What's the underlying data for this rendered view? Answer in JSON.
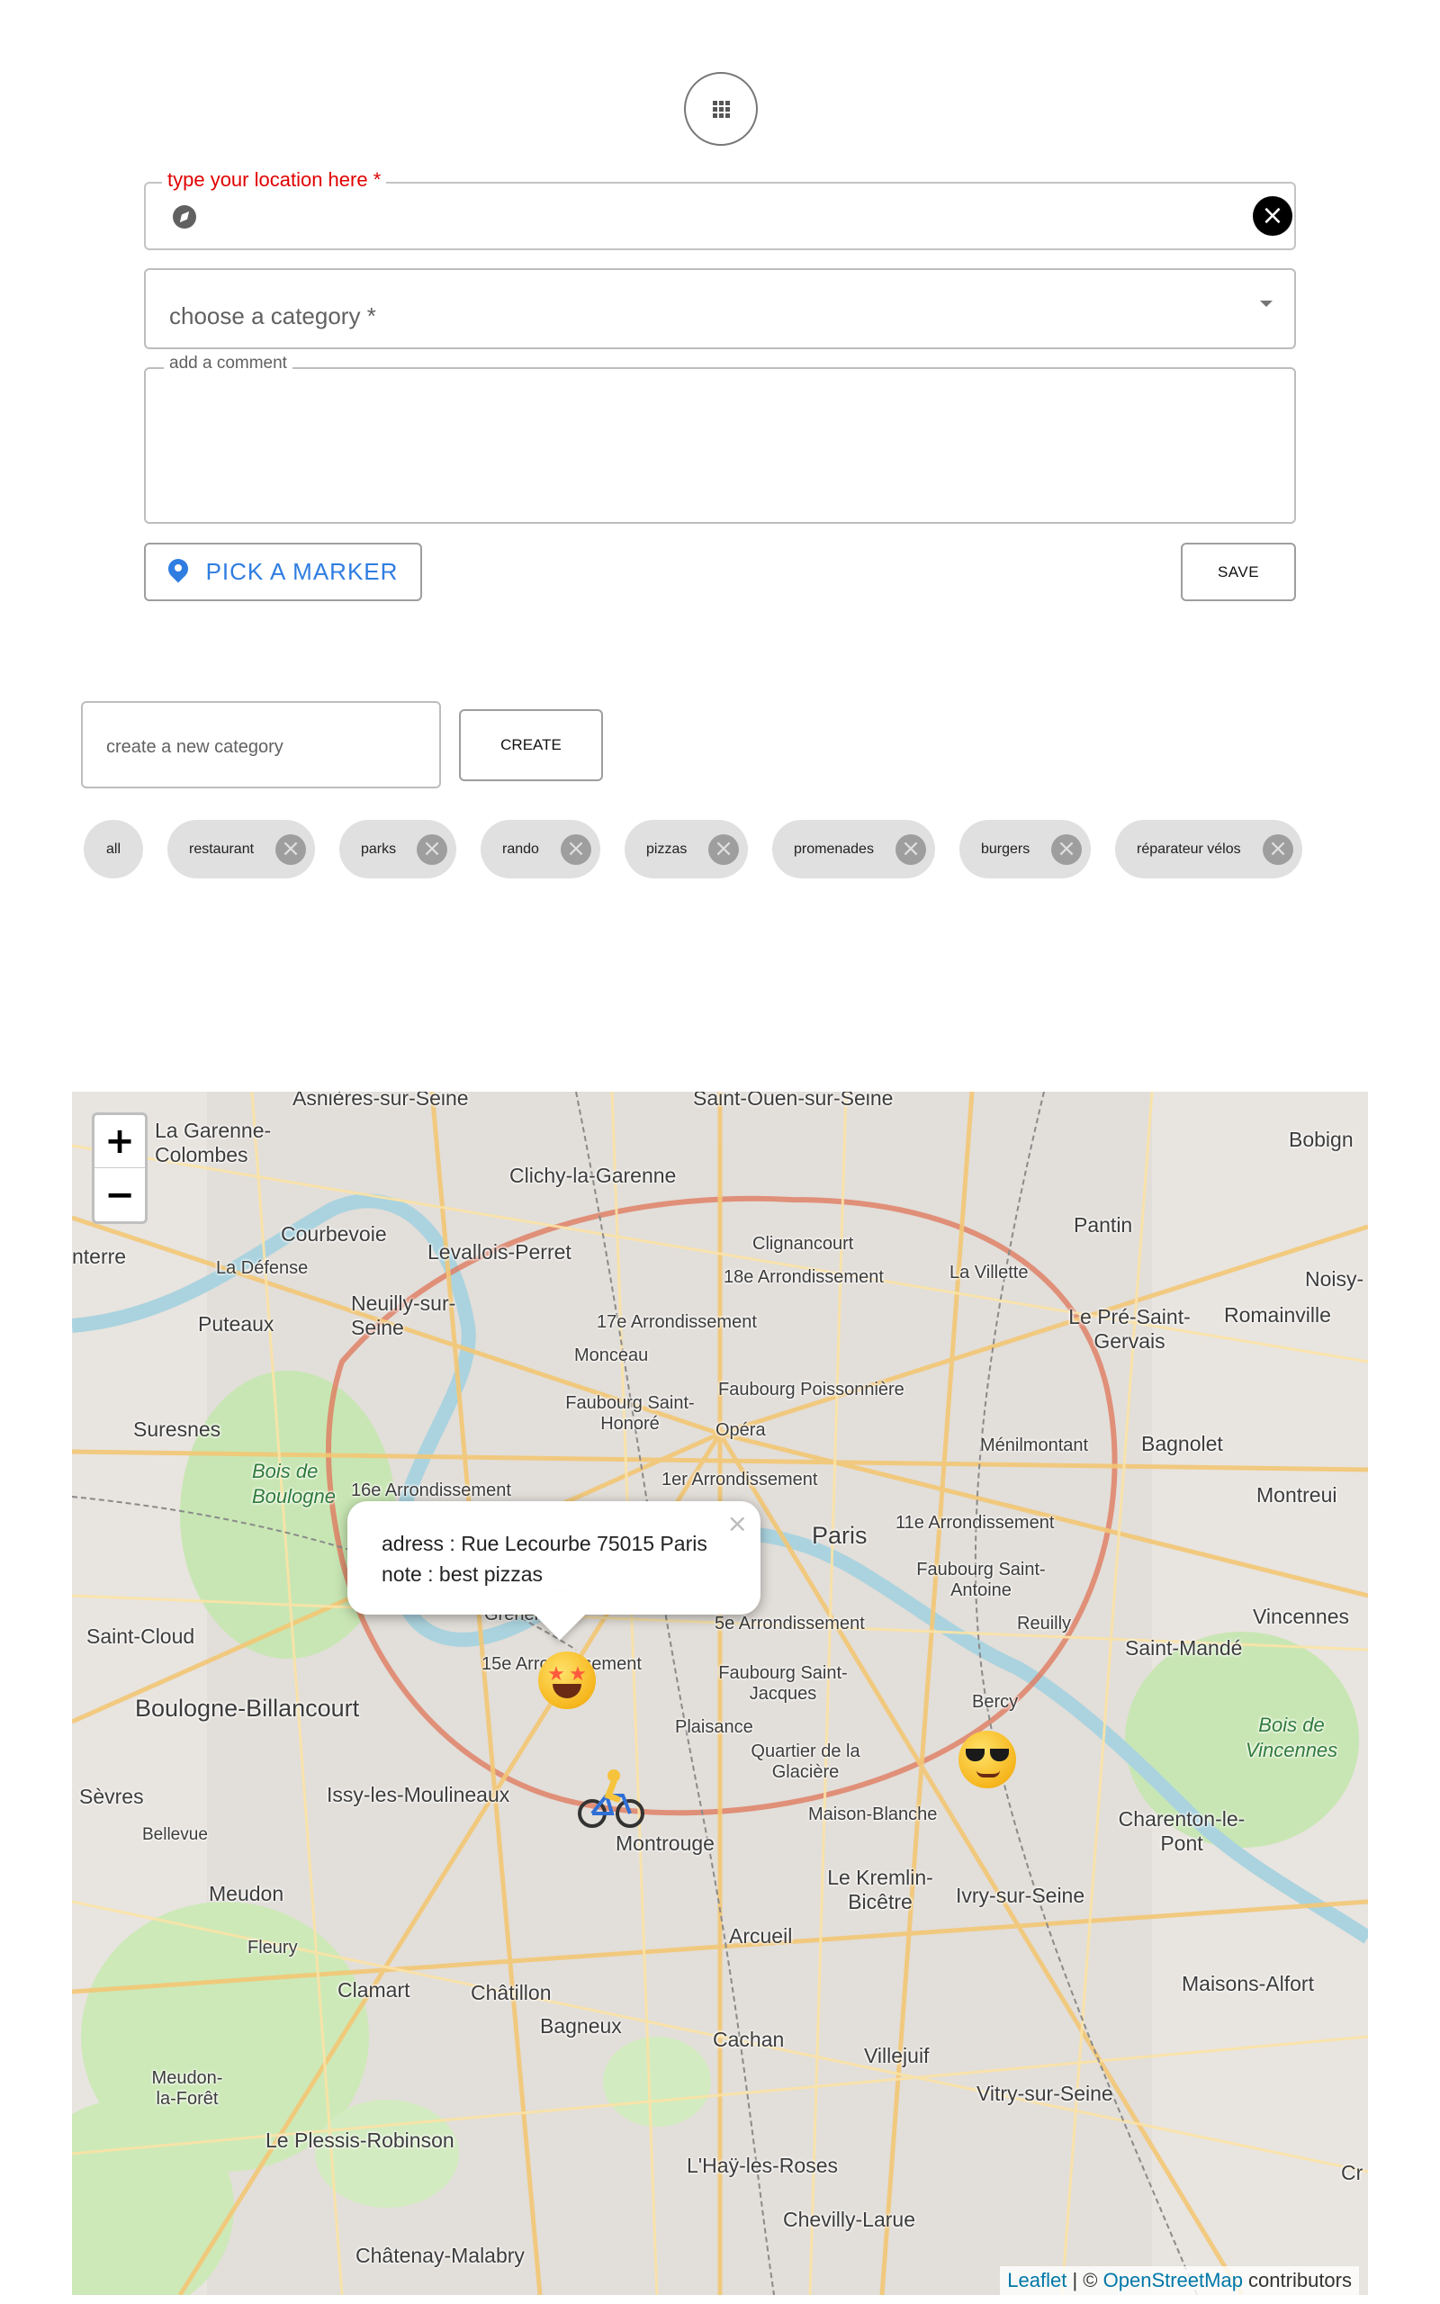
{
  "top": {
    "apps_icon": "apps-grid-icon"
  },
  "form": {
    "location": {
      "label": "type your location here *",
      "value": "",
      "left_icon": "compass-icon",
      "clear_icon": "close-circle-icon"
    },
    "category": {
      "placeholder": "choose a category *",
      "icon": "caret-down-icon"
    },
    "comment": {
      "label": "add a comment",
      "value": ""
    },
    "pick_marker": {
      "label": "PICK A MARKER",
      "icon": "map-pin-icon"
    },
    "save_label": "SAVE"
  },
  "category_manager": {
    "new_category_placeholder": "create a new category",
    "create_label": "CREATE"
  },
  "chips": [
    {
      "label": "all",
      "removable": false
    },
    {
      "label": "restaurant",
      "removable": true
    },
    {
      "label": "parks",
      "removable": true
    },
    {
      "label": "rando",
      "removable": true
    },
    {
      "label": "pizzas",
      "removable": true
    },
    {
      "label": "promenades",
      "removable": true
    },
    {
      "label": "burgers",
      "removable": true
    },
    {
      "label": "réparateur vélos",
      "removable": true
    }
  ],
  "map": {
    "zoom_in": "+",
    "zoom_out": "−",
    "popup": {
      "line1": "adress : Rue Lecourbe 75015 Paris",
      "line2": "note : best pizzas",
      "close": "×"
    },
    "markers": [
      "star-struck-emoji-icon",
      "cyclist-emoji-icon",
      "sunglasses-emoji-icon"
    ],
    "places": [
      "Asnières-sur-Seine",
      "Saint-Ouen-sur-Seine",
      "La Garenne-Colombes",
      "Clichy-la-Garenne",
      "Bobign",
      "Courbevoie",
      "Levallois-Perret",
      "Clignancourt",
      "Pantin",
      "nterre",
      "La Défense",
      "18e Arrondissement",
      "La Villette",
      "Noisy-",
      "Neuilly-sur-Seine",
      "Puteaux",
      "17e Arrondissement",
      "Le Pré-Saint-Gervais",
      "Romainville",
      "Monceau",
      "Faubourg Poissonnière",
      "Suresnes",
      "Faubourg Saint-Honoré",
      "Opéra",
      "Ménilmontant",
      "Bagnolet",
      "Bois de Boulogne",
      "16e Arrondissement",
      "1er Arrondissement",
      "Montreui",
      "Paris",
      "11e Arrondissement",
      "Faubourg Saint-Antoine",
      "Saint-Cloud",
      "Grenelle",
      "5e Arrondissement",
      "Reuilly",
      "Vincennes",
      "Saint-Mandé",
      "15e Arrondissement",
      "Faubourg Saint-Jacques",
      "Boulogne-Billancourt",
      "Bercy",
      "Bois de Vincennes",
      "Plaisance",
      "Quartier de la Glacière",
      "Sèvres",
      "Issy-les-Moulineaux",
      "Maison-Blanche",
      "Charenton-le-Pont",
      "Bellevue",
      "Montrouge",
      "Le Kremlin-Bicêtre",
      "Meudon",
      "Ivry-sur-Seine",
      "Arcueil",
      "Fleury",
      "Clamart",
      "Châtillon",
      "Maisons-Alfort",
      "Bagneux",
      "Cachan",
      "Villejuif",
      "Meudon-la-Forêt",
      "Vitry-sur-Seine",
      "Le Plessis-Robinson",
      "L'Haÿ-les-Roses",
      "Chevilly-Larue",
      "Châtenay-Malabry",
      "Cr"
    ],
    "attribution": {
      "leaflet": "Leaflet",
      "sep": " | © ",
      "osm": "OpenStreetMap",
      "rest": " contributors"
    }
  }
}
